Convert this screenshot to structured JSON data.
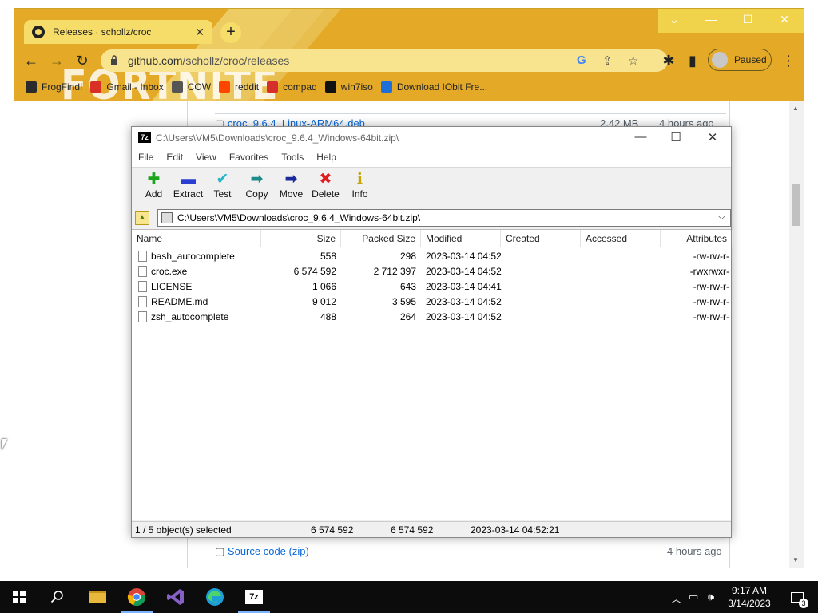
{
  "browser": {
    "tab_title": "Releases · schollz/croc",
    "url_host": "github.com",
    "url_path": "/schollz/croc/releases",
    "profile_label": "Paused",
    "theme_logo_text": "FORTNITE",
    "bookmarks": [
      {
        "label": "FrogFind!",
        "color": "#2b2b2b"
      },
      {
        "label": "Gmail - Inbox",
        "color": "#d93025"
      },
      {
        "label": "COW",
        "color": "#555555"
      },
      {
        "label": "reddit",
        "color": "#ff4500"
      },
      {
        "label": "compaq",
        "color": "#d62d2d"
      },
      {
        "label": "win7iso",
        "color": "#111111"
      },
      {
        "label": "Download IObit Fre...",
        "color": "#1e6fd9"
      }
    ]
  },
  "github": {
    "asset_top": {
      "name": "croc_9.6.4_Linux-ARM64.deb",
      "size": "2.42 MB",
      "age": "4 hours ago"
    },
    "asset_bottom": {
      "name": "Source code",
      "suffix": "(zip)",
      "age": "4 hours ago"
    }
  },
  "sevenzip": {
    "title": "C:\\Users\\VM5\\Downloads\\croc_9.6.4_Windows-64bit.zip\\",
    "menu": [
      "File",
      "Edit",
      "View",
      "Favorites",
      "Tools",
      "Help"
    ],
    "tools": [
      {
        "label": "Add",
        "icon": "plus-icon",
        "color": "#1aa51a",
        "glyph": "✚"
      },
      {
        "label": "Extract",
        "icon": "minus-icon",
        "color": "#2a3fd1",
        "glyph": "▬"
      },
      {
        "label": "Test",
        "icon": "check-icon",
        "color": "#22b5c8",
        "glyph": "✔"
      },
      {
        "label": "Copy",
        "icon": "double-arrow-icon",
        "color": "#1b8a8a",
        "glyph": "➡"
      },
      {
        "label": "Move",
        "icon": "arrow-right-icon",
        "color": "#1a2a9a",
        "glyph": "➡"
      },
      {
        "label": "Delete",
        "icon": "x-icon",
        "color": "#e01b1b",
        "glyph": "✖"
      },
      {
        "label": "Info",
        "icon": "info-icon",
        "color": "#c8a400",
        "glyph": "ℹ"
      }
    ],
    "address": "C:\\Users\\VM5\\Downloads\\croc_9.6.4_Windows-64bit.zip\\",
    "columns": [
      "Name",
      "Size",
      "Packed Size",
      "Modified",
      "Created",
      "Accessed",
      "Attributes"
    ],
    "files": [
      {
        "name": "bash_autocomplete",
        "size": "558",
        "packed": "298",
        "modified": "2023-03-14 04:52",
        "attr": "-rw-rw-r-"
      },
      {
        "name": "croc.exe",
        "size": "6 574 592",
        "packed": "2 712 397",
        "modified": "2023-03-14 04:52",
        "attr": "-rwxrwxr-"
      },
      {
        "name": "LICENSE",
        "size": "1 066",
        "packed": "643",
        "modified": "2023-03-14 04:41",
        "attr": "-rw-rw-r-"
      },
      {
        "name": "README.md",
        "size": "9 012",
        "packed": "3 595",
        "modified": "2023-03-14 04:52",
        "attr": "-rw-rw-r-"
      },
      {
        "name": "zsh_autocomplete",
        "size": "488",
        "packed": "264",
        "modified": "2023-03-14 04:52",
        "attr": "-rw-rw-r-"
      }
    ],
    "status": {
      "selected": "1 / 5 object(s) selected",
      "size": "6 574 592",
      "packed": "6 574 592",
      "modified": "2023-03-14 04:52:21"
    }
  },
  "taskbar": {
    "time": "9:17 AM",
    "date": "3/14/2023",
    "notification_count": "3"
  }
}
